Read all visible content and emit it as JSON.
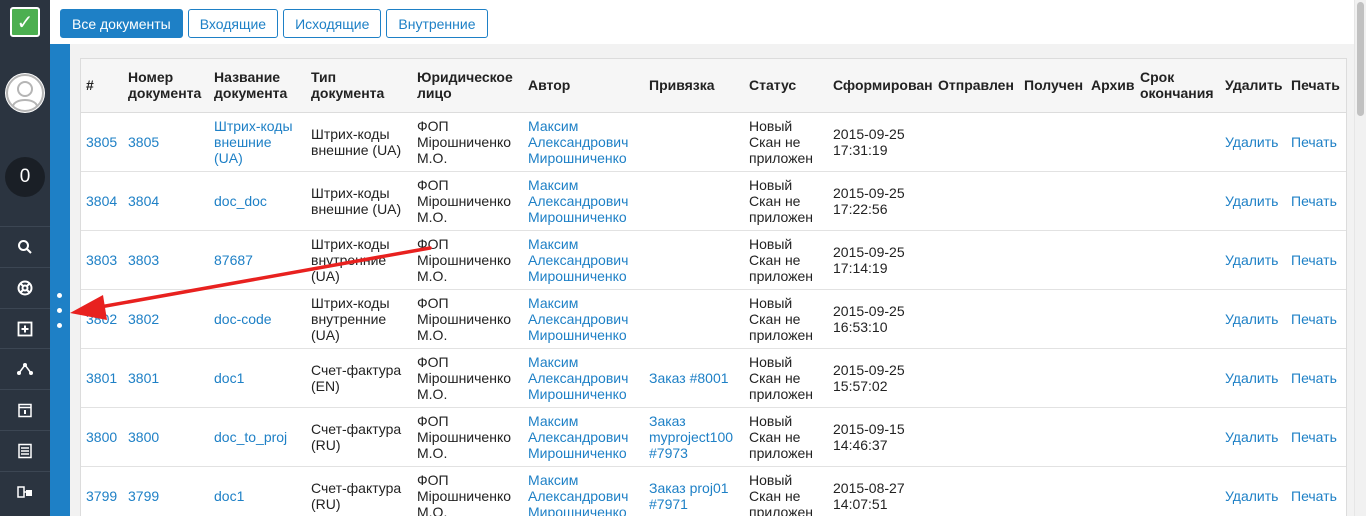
{
  "logo": {
    "icon": "check-icon",
    "glyph": "✓",
    "color": "#4caf50"
  },
  "sidebar": {
    "counter": "0",
    "items": [
      {
        "icon": "search-icon"
      },
      {
        "icon": "support-icon"
      },
      {
        "icon": "add-document-icon"
      },
      {
        "icon": "share-icon"
      },
      {
        "icon": "calendar-icon"
      },
      {
        "icon": "list-icon"
      },
      {
        "icon": "transfer-icon"
      }
    ]
  },
  "tabs": [
    {
      "label": "Все документы",
      "active": true
    },
    {
      "label": "Входящие",
      "active": false
    },
    {
      "label": "Исходящие",
      "active": false
    },
    {
      "label": "Внутренние",
      "active": false
    }
  ],
  "table": {
    "headers": {
      "id": "#",
      "number": "Номер документа",
      "name": "Название документа",
      "type": "Тип документа",
      "entity": "Юридическое лицо",
      "author": "Автор",
      "binding": "Привязка",
      "status": "Статус",
      "formed": "Сформирован",
      "sent": "Отправлен",
      "received": "Получен",
      "archive": "Архив",
      "deadline": "Срок окончания",
      "delete": "Удалить",
      "print": "Печать"
    },
    "rows": [
      {
        "id": "3805",
        "number": "3805",
        "name": "Штрих-коды внешние (UA)",
        "type": "Штрих-коды внешние (UA)",
        "entity": "ФОП Мірошниченко М.О.",
        "author": "Максим Александрович Мирошниченко",
        "binding": "",
        "status": "Новый Скан не приложен",
        "formed": "2015-09-25 17:31:19",
        "delete": "Удалить",
        "print": "Печать"
      },
      {
        "id": "3804",
        "number": "3804",
        "name": "doc_doc",
        "type": "Штрих-коды внешние (UA)",
        "entity": "ФОП Мірошниченко М.О.",
        "author": "Максим Александрович Мирошниченко",
        "binding": "",
        "status": "Новый Скан не приложен",
        "formed": "2015-09-25 17:22:56",
        "delete": "Удалить",
        "print": "Печать"
      },
      {
        "id": "3803",
        "number": "3803",
        "name": "87687",
        "type": "Штрих-коды внутренние (UA)",
        "entity": "ФОП Мірошниченко М.О.",
        "author": "Максим Александрович Мирошниченко",
        "binding": "",
        "status": "Новый Скан не приложен",
        "formed": "2015-09-25 17:14:19",
        "delete": "Удалить",
        "print": "Печать"
      },
      {
        "id": "3802",
        "number": "3802",
        "name": "doc-code",
        "type": "Штрих-коды внутренние (UA)",
        "entity": "ФОП Мірошниченко М.О.",
        "author": "Максим Александрович Мирошниченко",
        "binding": "",
        "status": "Новый Скан не приложен",
        "formed": "2015-09-25 16:53:10",
        "delete": "Удалить",
        "print": "Печать"
      },
      {
        "id": "3801",
        "number": "3801",
        "name": "doc1",
        "type": "Счет-фактура (EN)",
        "entity": "ФОП Мірошниченко М.О.",
        "author": "Максим Александрович Мирошниченко",
        "binding": "Заказ #8001",
        "status": "Новый Скан не приложен",
        "formed": "2015-09-25 15:57:02",
        "delete": "Удалить",
        "print": "Печать"
      },
      {
        "id": "3800",
        "number": "3800",
        "name": "doc_to_proj",
        "type": "Счет-фактура (RU)",
        "entity": "ФОП Мірошниченко М.О.",
        "author": "Максим Александрович Мирошниченко",
        "binding": "Заказ myproject100 #7973",
        "status": "Новый Скан не приложен",
        "formed": "2015-09-15 14:46:37",
        "delete": "Удалить",
        "print": "Печать"
      },
      {
        "id": "3799",
        "number": "3799",
        "name": "doc1",
        "type": "Счет-фактура (RU)",
        "entity": "ФОП Мірошниченко М.О.",
        "author": "Максим Александрович Мирошниченко",
        "binding": "Заказ proj01 #7971",
        "status": "Новый Скан не приложен",
        "formed": "2015-08-27 14:07:51",
        "delete": "Удалить",
        "print": "Печать"
      }
    ]
  },
  "annotation": {
    "arrow_color": "#e8211f",
    "arrow_icon": "arrow-annotation-icon"
  },
  "colors": {
    "accent": "#1e80c6",
    "sidebar": "#2b3440"
  }
}
